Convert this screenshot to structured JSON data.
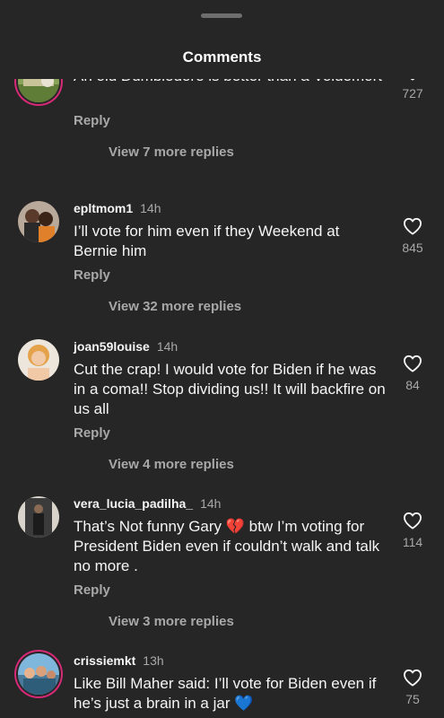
{
  "header": {
    "title": "Comments"
  },
  "comments": [
    {
      "username": "",
      "time": "",
      "text": "An old Dumbledore is better than a Voldemort",
      "reply_label": "Reply",
      "view_replies": "View 7 more replies",
      "likes": "727",
      "avatar_icon": "avatar-photo",
      "story_ring": true
    },
    {
      "username": "epltmom1",
      "time": "14h",
      "text": "I’ll vote for him even if they Weekend at Bernie him",
      "reply_label": "Reply",
      "view_replies": "View 32 more replies",
      "likes": "845",
      "avatar_icon": "avatar-photo",
      "story_ring": false
    },
    {
      "username": "joan59louise",
      "time": "14h",
      "text": "Cut the crap!  I would vote for Biden if he was in a coma!! Stop dividing us!! It will backfire on us all",
      "reply_label": "Reply",
      "view_replies": "View 4 more replies",
      "likes": "84",
      "avatar_icon": "avatar-photo",
      "story_ring": false
    },
    {
      "username": "vera_lucia_padilha_",
      "time": "14h",
      "text_before_emoji": "That’s Not funny Gary ",
      "emoji": "💔",
      "text_after_emoji": " btw I’m voting for President Biden even if couldn’t walk and talk no more .",
      "reply_label": "Reply",
      "view_replies": "View 3 more replies",
      "likes": "114",
      "avatar_icon": "avatar-photo",
      "story_ring": false
    },
    {
      "username": "crissiemkt",
      "time": "13h",
      "text_before_emoji": "Like Bill Maher said: I’ll vote for Biden even if he’s just a brain in a jar ",
      "emoji": "💙",
      "text_after_emoji": "",
      "reply_label": "",
      "view_replies": "",
      "likes": "75",
      "avatar_icon": "avatar-photo",
      "story_ring": true
    }
  ],
  "colors": {
    "background": "#262626",
    "primary_text": "#f5f5f5",
    "secondary_text": "#a8a8a8",
    "story_ring": "#d62976"
  }
}
